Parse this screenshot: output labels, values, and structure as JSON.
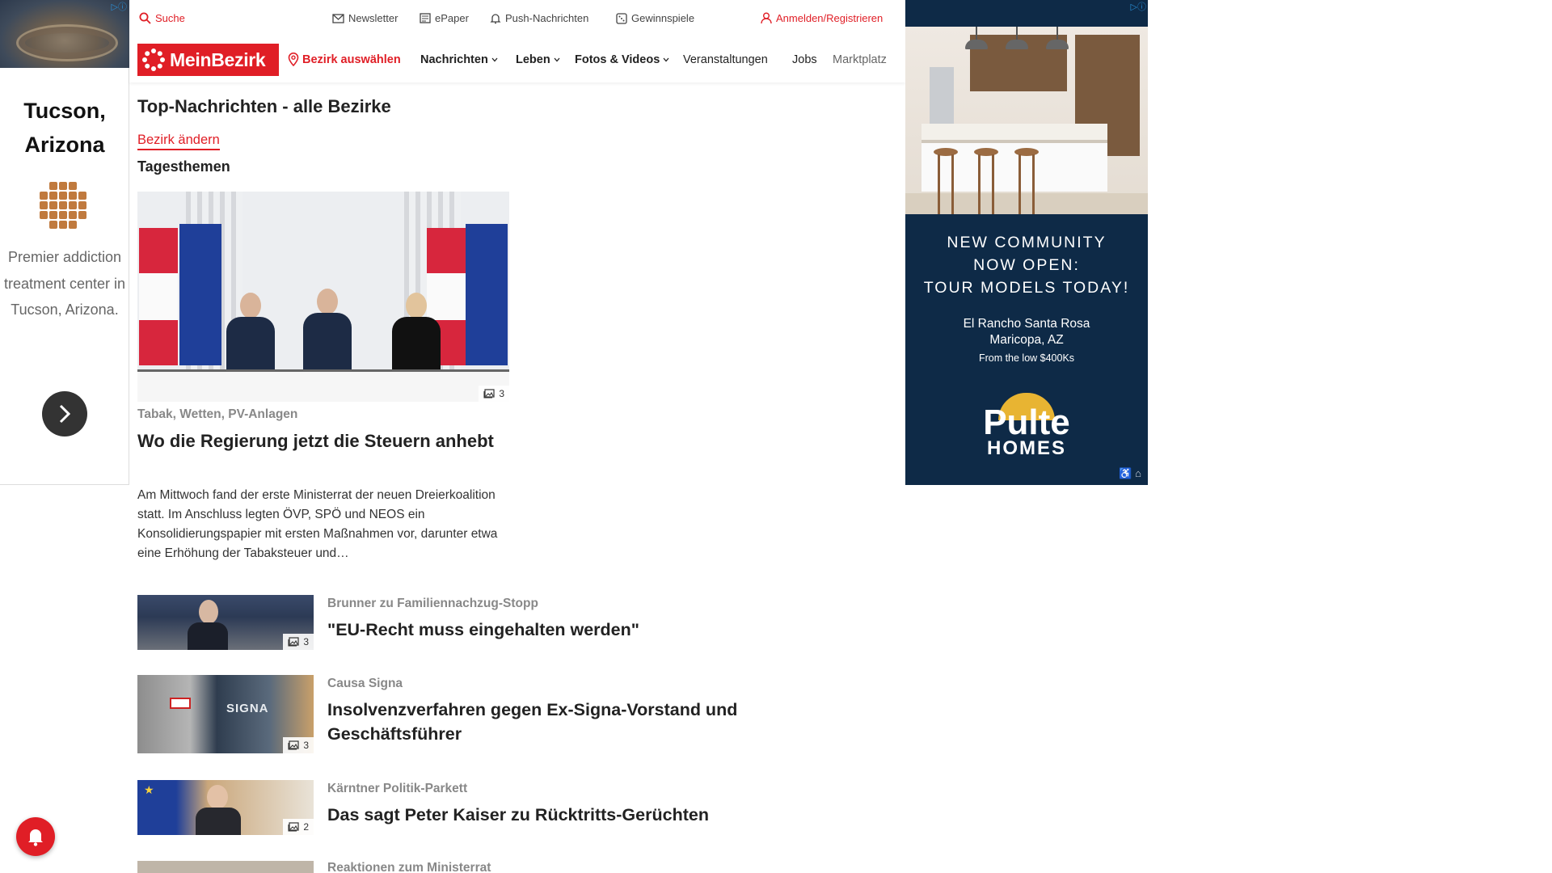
{
  "ads": {
    "left": {
      "headline": "Tucson, Arizona",
      "copy": "Premier addiction treatment center in Tucson, Arizona."
    },
    "right": {
      "cta": [
        "NEW COMMUNITY",
        "NOW OPEN:",
        "TOUR MODELS TODAY!"
      ],
      "place_line1": "El Rancho Santa Rosa",
      "place_line2": "Maricopa, AZ",
      "price": "From the low $400Ks",
      "brand": "Pulte",
      "brand_sub": "HOMES"
    }
  },
  "topbar": {
    "search": "Suche",
    "newsletter": "Newsletter",
    "epaper": "ePaper",
    "push": "Push-Nachrichten",
    "contests": "Gewinnspiele",
    "login": "Anmelden/Registrieren"
  },
  "nav": {
    "logo": "MeinBezirk",
    "bezirk": "Bezirk auswählen",
    "news": "Nachrichten",
    "leben": "Leben",
    "fotos": "Fotos & Videos",
    "events": "Veranstaltungen",
    "jobs": "Jobs",
    "markt": "Marktplatz"
  },
  "main": {
    "page_title": "Top-Nachrichten - alle Bezirke",
    "change_link": "Bezirk ändern",
    "section": "Tagesthemen",
    "hero": {
      "kicker": "Tabak, Wetten, PV-Anlagen",
      "title": "Wo die Regierung jetzt die Steuern anhebt",
      "teaser": "Am Mittwoch fand der erste Ministerrat der neuen Dreierkoalition statt. Im Anschluss legten ÖVP, SPÖ und NEOS ein Konsolidierungspapier mit ersten Maßnahmen vor, darunter etwa eine Erhöhung der Tabaksteuer und…",
      "image_count": "3"
    },
    "articles": [
      {
        "kicker": "Brunner zu Familiennachzug-Stopp",
        "title": "\"EU-Recht muss eingehalten werden\"",
        "image_count": "3"
      },
      {
        "kicker": "Causa Signa",
        "title": "Insolvenzverfahren gegen Ex-Signa-Vorstand und Geschäftsführer",
        "image_count": "3",
        "thumb_text": "SIGNA"
      },
      {
        "kicker": "Kärntner Politik-Parkett",
        "title": "Das sagt Peter Kaiser zu Rücktritts-Gerüchten",
        "image_count": "2"
      },
      {
        "kicker": "Reaktionen zum Ministerrat",
        "title": ""
      }
    ]
  },
  "colors": {
    "brand_red": "#e01e26",
    "ad_navy": "#0e2a47"
  }
}
